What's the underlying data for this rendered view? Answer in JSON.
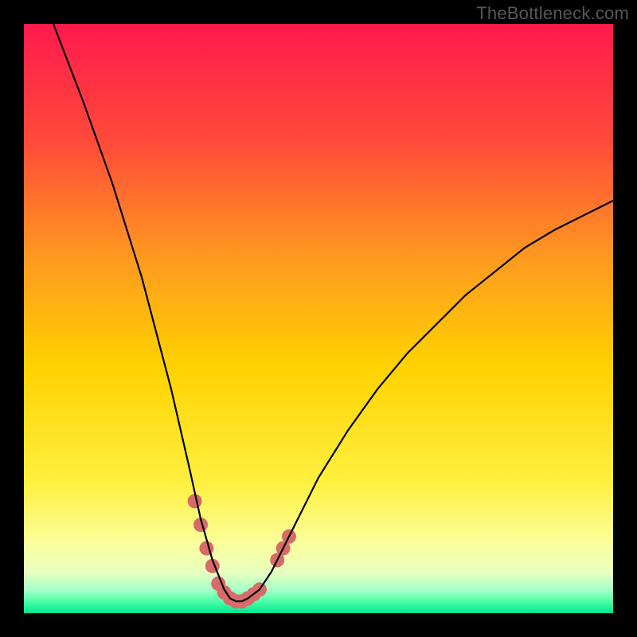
{
  "watermark": "TheBottleneck.com",
  "colors": {
    "gradient_top": "#ff1a4d",
    "gradient_upper": "#ff6a2a",
    "gradient_mid": "#ffd200",
    "gradient_lower": "#fff77a",
    "gradient_bottom_green": "#00e676",
    "curve": "#000000",
    "marker": "#d86a6a",
    "frame": "#000000"
  },
  "chart_data": {
    "type": "line",
    "title": "",
    "xlabel": "",
    "ylabel": "",
    "xlim": [
      0,
      100
    ],
    "ylim": [
      0,
      100
    ],
    "series": [
      {
        "name": "bottleneck-curve",
        "x": [
          5,
          10,
          15,
          20,
          25,
          28,
          30,
          32,
          34,
          35,
          36,
          37,
          38,
          40,
          42,
          45,
          50,
          55,
          60,
          65,
          70,
          75,
          80,
          85,
          90,
          95,
          100
        ],
        "y": [
          100,
          87,
          73,
          57,
          38,
          25,
          16,
          9,
          4,
          2.5,
          2,
          2,
          2.5,
          4,
          7,
          13,
          23,
          31,
          38,
          44,
          49,
          54,
          58,
          62,
          65,
          67.5,
          70
        ]
      }
    ],
    "markers": {
      "name": "highlight-segments",
      "points": [
        {
          "x": 29,
          "y": 19
        },
        {
          "x": 30,
          "y": 15
        },
        {
          "x": 31,
          "y": 11
        },
        {
          "x": 32,
          "y": 8
        },
        {
          "x": 33,
          "y": 5
        },
        {
          "x": 34,
          "y": 3.5
        },
        {
          "x": 35,
          "y": 2.5
        },
        {
          "x": 36,
          "y": 2
        },
        {
          "x": 37,
          "y": 2
        },
        {
          "x": 38,
          "y": 2.5
        },
        {
          "x": 39,
          "y": 3.2
        },
        {
          "x": 40,
          "y": 4
        },
        {
          "x": 43,
          "y": 9
        },
        {
          "x": 44,
          "y": 11
        },
        {
          "x": 45,
          "y": 13
        }
      ]
    }
  }
}
